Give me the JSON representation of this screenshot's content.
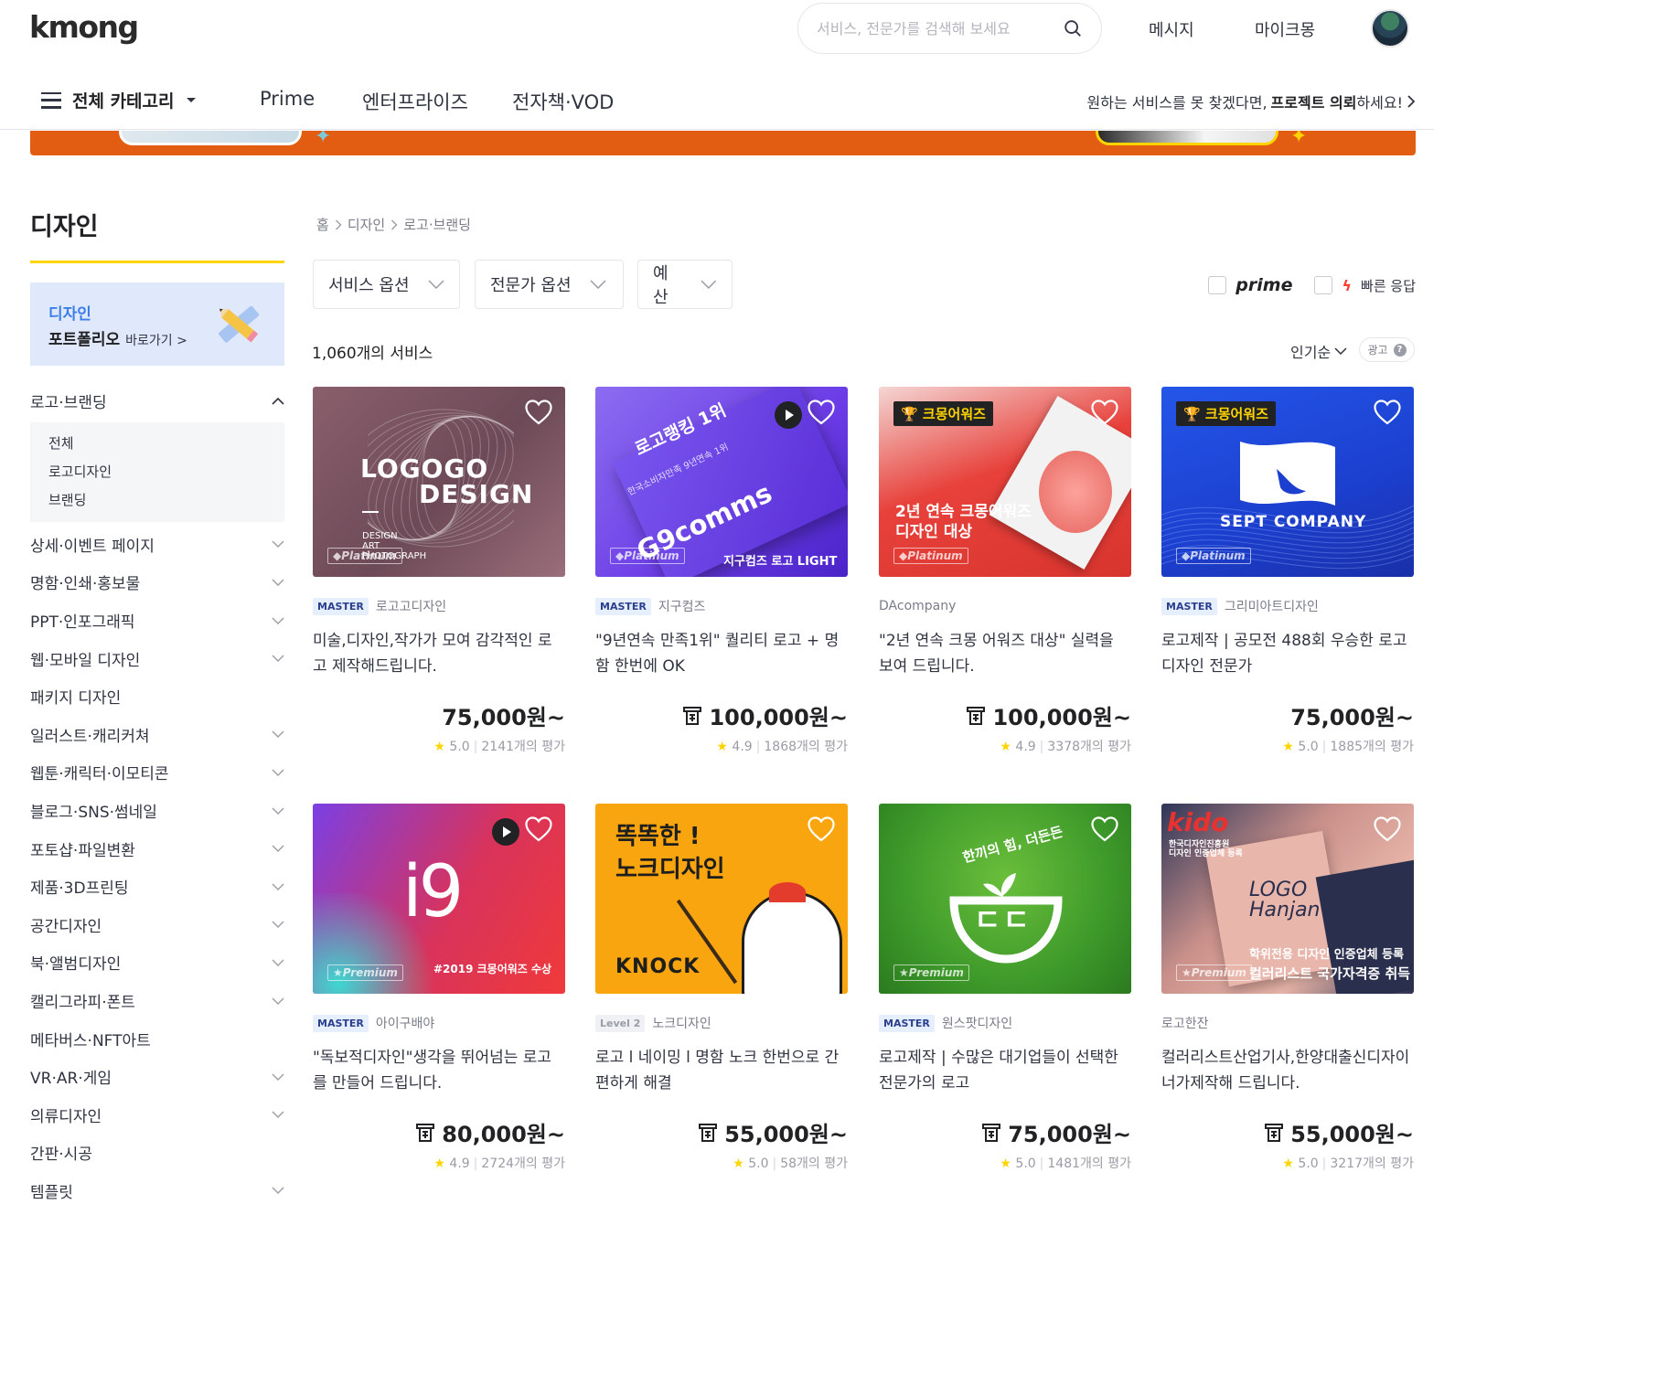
{
  "header": {
    "logo": "kmong",
    "search_placeholder": "서비스, 전문가를 검색해 보세요",
    "messages": "메시지",
    "my": "마이크몽"
  },
  "nav": {
    "all_categories": "전체 카테고리",
    "items": [
      "Prime",
      "엔터프라이즈",
      "전자책·VOD"
    ],
    "promo_prefix": "원하는 서비스를 못 찾겠다면,",
    "promo_bold": "프로젝트 의뢰",
    "promo_suffix": "하세요!"
  },
  "sidebar": {
    "title": "디자인",
    "portfolio_line1": "디자인",
    "portfolio_line2": "포트폴리오",
    "portfolio_link": "바로가기 >",
    "open_category": "로고·브랜딩",
    "sub_items": [
      "전체",
      "로고디자인",
      "브랜딩"
    ],
    "categories": [
      {
        "label": "상세·이벤트 페이지",
        "expandable": true
      },
      {
        "label": "명함·인쇄·홍보물",
        "expandable": true
      },
      {
        "label": "PPT·인포그래픽",
        "expandable": true
      },
      {
        "label": "웹·모바일 디자인",
        "expandable": true
      },
      {
        "label": "패키지 디자인",
        "expandable": false
      },
      {
        "label": "일러스트·캐리커쳐",
        "expandable": true
      },
      {
        "label": "웹툰·캐릭터·이모티콘",
        "expandable": true
      },
      {
        "label": "블로그·SNS·썸네일",
        "expandable": true
      },
      {
        "label": "포토샵·파일변환",
        "expandable": true
      },
      {
        "label": "제품·3D프린팅",
        "expandable": true
      },
      {
        "label": "공간디자인",
        "expandable": true
      },
      {
        "label": "북·앨범디자인",
        "expandable": true
      },
      {
        "label": "캘리그라피·폰트",
        "expandable": true
      },
      {
        "label": "메타버스·NFT아트",
        "expandable": false
      },
      {
        "label": "VR·AR·게임",
        "expandable": true
      },
      {
        "label": "의류디자인",
        "expandable": true
      },
      {
        "label": "간판·시공",
        "expandable": false
      },
      {
        "label": "템플릿",
        "expandable": true
      }
    ]
  },
  "main": {
    "breadcrumb": [
      "홈",
      "디자인",
      "로고·브랜딩"
    ],
    "filters": [
      "서비스 옵션",
      "전문가 옵션",
      "예산"
    ],
    "prime_label": "prime",
    "fast_label": "빠른 응답",
    "count": "1,060개의 서비스",
    "sort": "인기순",
    "ad": "광고",
    "cards": [
      {
        "seller_badge": "MASTER",
        "seller": "로고고디자인",
        "title": "미술,디자인,작가가 모여 감각적인 로고 제작해드립니다.",
        "price": "75,000원~",
        "rating": "5.0",
        "reviews": "2141개의 평가",
        "thumb_lines": [
          "LOGOGO",
          "DESIGN"
        ],
        "thumb_small": [
          "DESIGN",
          "ART",
          "PHOTOGRAPH"
        ],
        "tier": "Platinum",
        "award": "",
        "video": false,
        "pay_icon": false
      },
      {
        "seller_badge": "MASTER",
        "seller": "지구컴즈",
        "title": "\"9년연속 만족1위\" 퀄리티 로고 + 명함 한번에 OK",
        "price": "100,000원~",
        "rating": "4.9",
        "reviews": "1868개의 평가",
        "thumb_lines": [
          "로고랭킹 1위",
          "G9comms"
        ],
        "thumb_small": [
          "한국소비자만족 9년연속 1위"
        ],
        "thumb_caption": "지구컴즈 로고 LIGHT",
        "tier": "Platinum",
        "award": "",
        "video": true,
        "pay_icon": true
      },
      {
        "seller_badge": "",
        "seller": "DAcompany",
        "title": "\"2년 연속 크몽 어워즈 대상\" 실력을 보여 드립니다.",
        "price": "100,000원~",
        "rating": "4.9",
        "reviews": "3378개의 평가",
        "thumb_lines": [
          "2년 연속 크몽어워즈",
          "디자인 대상"
        ],
        "tier": "Platinum",
        "award": "크몽어워즈",
        "video": false,
        "pay_icon": true
      },
      {
        "seller_badge": "MASTER",
        "seller": "그리미아트디자인",
        "title": "로고제작 | 공모전 488회 우승한 로고디자인 전문가",
        "price": "75,000원~",
        "rating": "5.0",
        "reviews": "1885개의 평가",
        "thumb_lines": [
          "SEPT COMPANY"
        ],
        "tier": "Platinum",
        "award": "크몽어워즈",
        "video": false,
        "pay_icon": false
      },
      {
        "seller_badge": "MASTER",
        "seller": "아이구배야",
        "title": "\"독보적디자인\"생각을 뛰어넘는 로고를 만들어 드립니다.",
        "price": "80,000원~",
        "rating": "4.9",
        "reviews": "2724개의 평가",
        "thumb_lines": [
          "i9"
        ],
        "thumb_caption": "#2019 크몽어워즈 수상",
        "tier": "Premium",
        "award": "",
        "video": true,
        "pay_icon": true
      },
      {
        "seller_badge": "Level 2",
        "seller": "노크디자인",
        "title": "로고 l 네이밍 l 명함 노크 한번으로 간편하게 해결",
        "price": "55,000원~",
        "rating": "5.0",
        "reviews": "58개의 평가",
        "thumb_lines": [
          "똑똑한 !",
          "노크디자인"
        ],
        "thumb_caption": "KNOCK",
        "tier": "",
        "award": "",
        "video": false,
        "pay_icon": true
      },
      {
        "seller_badge": "MASTER",
        "seller": "원스팟디자인",
        "title": "로고제작 | 수많은 대기업들이 선택한 전문가의 로고",
        "price": "75,000원~",
        "rating": "5.0",
        "reviews": "1481개의 평가",
        "thumb_lines": [
          "한끼의 힘, 더든든",
          "ㄷㄷ"
        ],
        "tier": "Premium",
        "award": "",
        "video": false,
        "pay_icon": true
      },
      {
        "seller_badge": "",
        "seller": "로고한잔",
        "title": "컬러리스트산업기사,한양대출신디자이너가제작해 드립니다.",
        "price": "55,000원~",
        "rating": "5.0",
        "reviews": "3217개의 평가",
        "thumb_lines": [
          "kido",
          "LOGO Hanjan"
        ],
        "thumb_small": [
          "한국디자인진흥원",
          "디자인 인증업체 등록"
        ],
        "thumb_caption_lines": [
          "학위전용 디자인 인증업체 등록",
          "컬러리스트 국가자격증 취득"
        ],
        "tier": "Premium",
        "award": "",
        "video": false,
        "pay_icon": true
      }
    ]
  },
  "colors": {
    "brand_yellow": "#ffd400",
    "banner_orange": "#e25c11",
    "master_badge_bg": "#e6efff",
    "link_blue": "#3c7ee8"
  }
}
